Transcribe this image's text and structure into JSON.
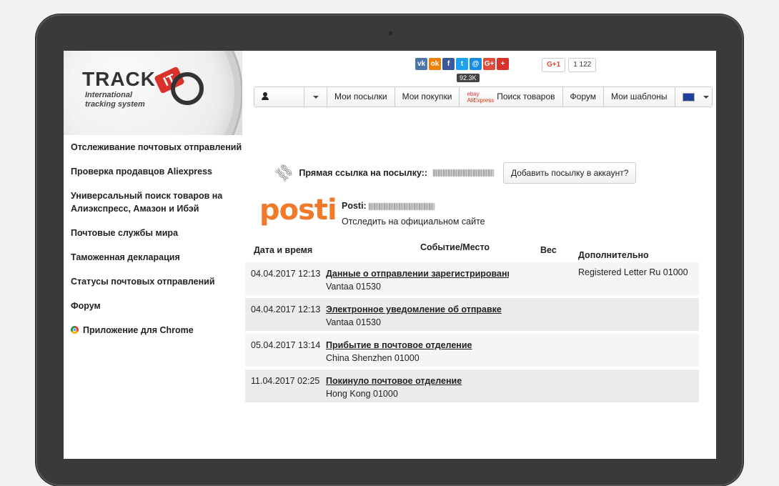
{
  "logo": {
    "main": "TRACK",
    "badge": "IT",
    "subtitle_line1": "International",
    "subtitle_line2": "tracking system"
  },
  "sidebar": {
    "items": [
      {
        "label": "Отслеживание почтовых отправлений"
      },
      {
        "label": "Проверка продавцов Aliexpress"
      },
      {
        "label": "Универсальный поиск товаров на Алиэкспресс, Амазон и Ибэй"
      },
      {
        "label": "Почтовые службы мира"
      },
      {
        "label": "Таможенная декларация"
      },
      {
        "label": "Статусы почтовых отправлений"
      },
      {
        "label": "Форум"
      },
      {
        "label": "Приложение для Chrome"
      }
    ]
  },
  "social": {
    "icons": [
      {
        "name": "vk-icon",
        "glyph": "vk",
        "color": "#4a76a8"
      },
      {
        "name": "ok-icon",
        "glyph": "ok",
        "color": "#ee8208"
      },
      {
        "name": "facebook-icon",
        "glyph": "f",
        "color": "#3b5998"
      },
      {
        "name": "twitter-icon",
        "glyph": "t",
        "color": "#1da1f2"
      },
      {
        "name": "mailru-icon",
        "glyph": "@",
        "color": "#168de2"
      },
      {
        "name": "gplus-share-icon",
        "glyph": "G+",
        "color": "#dd4b39"
      },
      {
        "name": "more-share-icon",
        "glyph": "+",
        "color": "#d8322b"
      }
    ],
    "count": "92.3K",
    "gplus_label": "G+1",
    "gplus_count": "1 122"
  },
  "nav": {
    "items": [
      {
        "label": "Мои посылки"
      },
      {
        "label": "Мои покупки"
      },
      {
        "label": "Поиск товаров"
      },
      {
        "label": "Форум"
      },
      {
        "label": "Мои шаблоны"
      }
    ],
    "ebay_text": "ebay",
    "ali_text": "AliExpress"
  },
  "parcel": {
    "direct_link_label": "Прямая ссылка на посылку::",
    "add_button": "Добавить посылку в аккаунт?",
    "carrier_logo": "posti",
    "carrier_label": "Posti:",
    "official_site": "Отследить на официальном сайте"
  },
  "table": {
    "headers": {
      "date": "Дата и время",
      "event": "Событие/Место",
      "weight": "Вес",
      "extra": "Дополнительно"
    },
    "rows": [
      {
        "date": "04.04.2017 12:13",
        "event": "Данные о отправлении зарегистрированы",
        "place": "Vantaa 01530",
        "weight": "",
        "extra": "Registered Letter Ru 01000"
      },
      {
        "date": "04.04.2017 12:13",
        "event": "Электронное уведомление об отправке",
        "place": "Vantaa 01530",
        "weight": "",
        "extra": ""
      },
      {
        "date": "05.04.2017 13:14",
        "event": "Прибытие в почтовое отделение",
        "place": "China Shenzhen 01000",
        "weight": "",
        "extra": ""
      },
      {
        "date": "11.04.2017 02:25",
        "event": "Покинуло почтовое отделение",
        "place": "Hong Kong 01000",
        "weight": "",
        "extra": ""
      }
    ]
  },
  "colors": {
    "accent": "#d8322b",
    "posti": "#f07a2a",
    "frame": "#3a3a3a"
  }
}
